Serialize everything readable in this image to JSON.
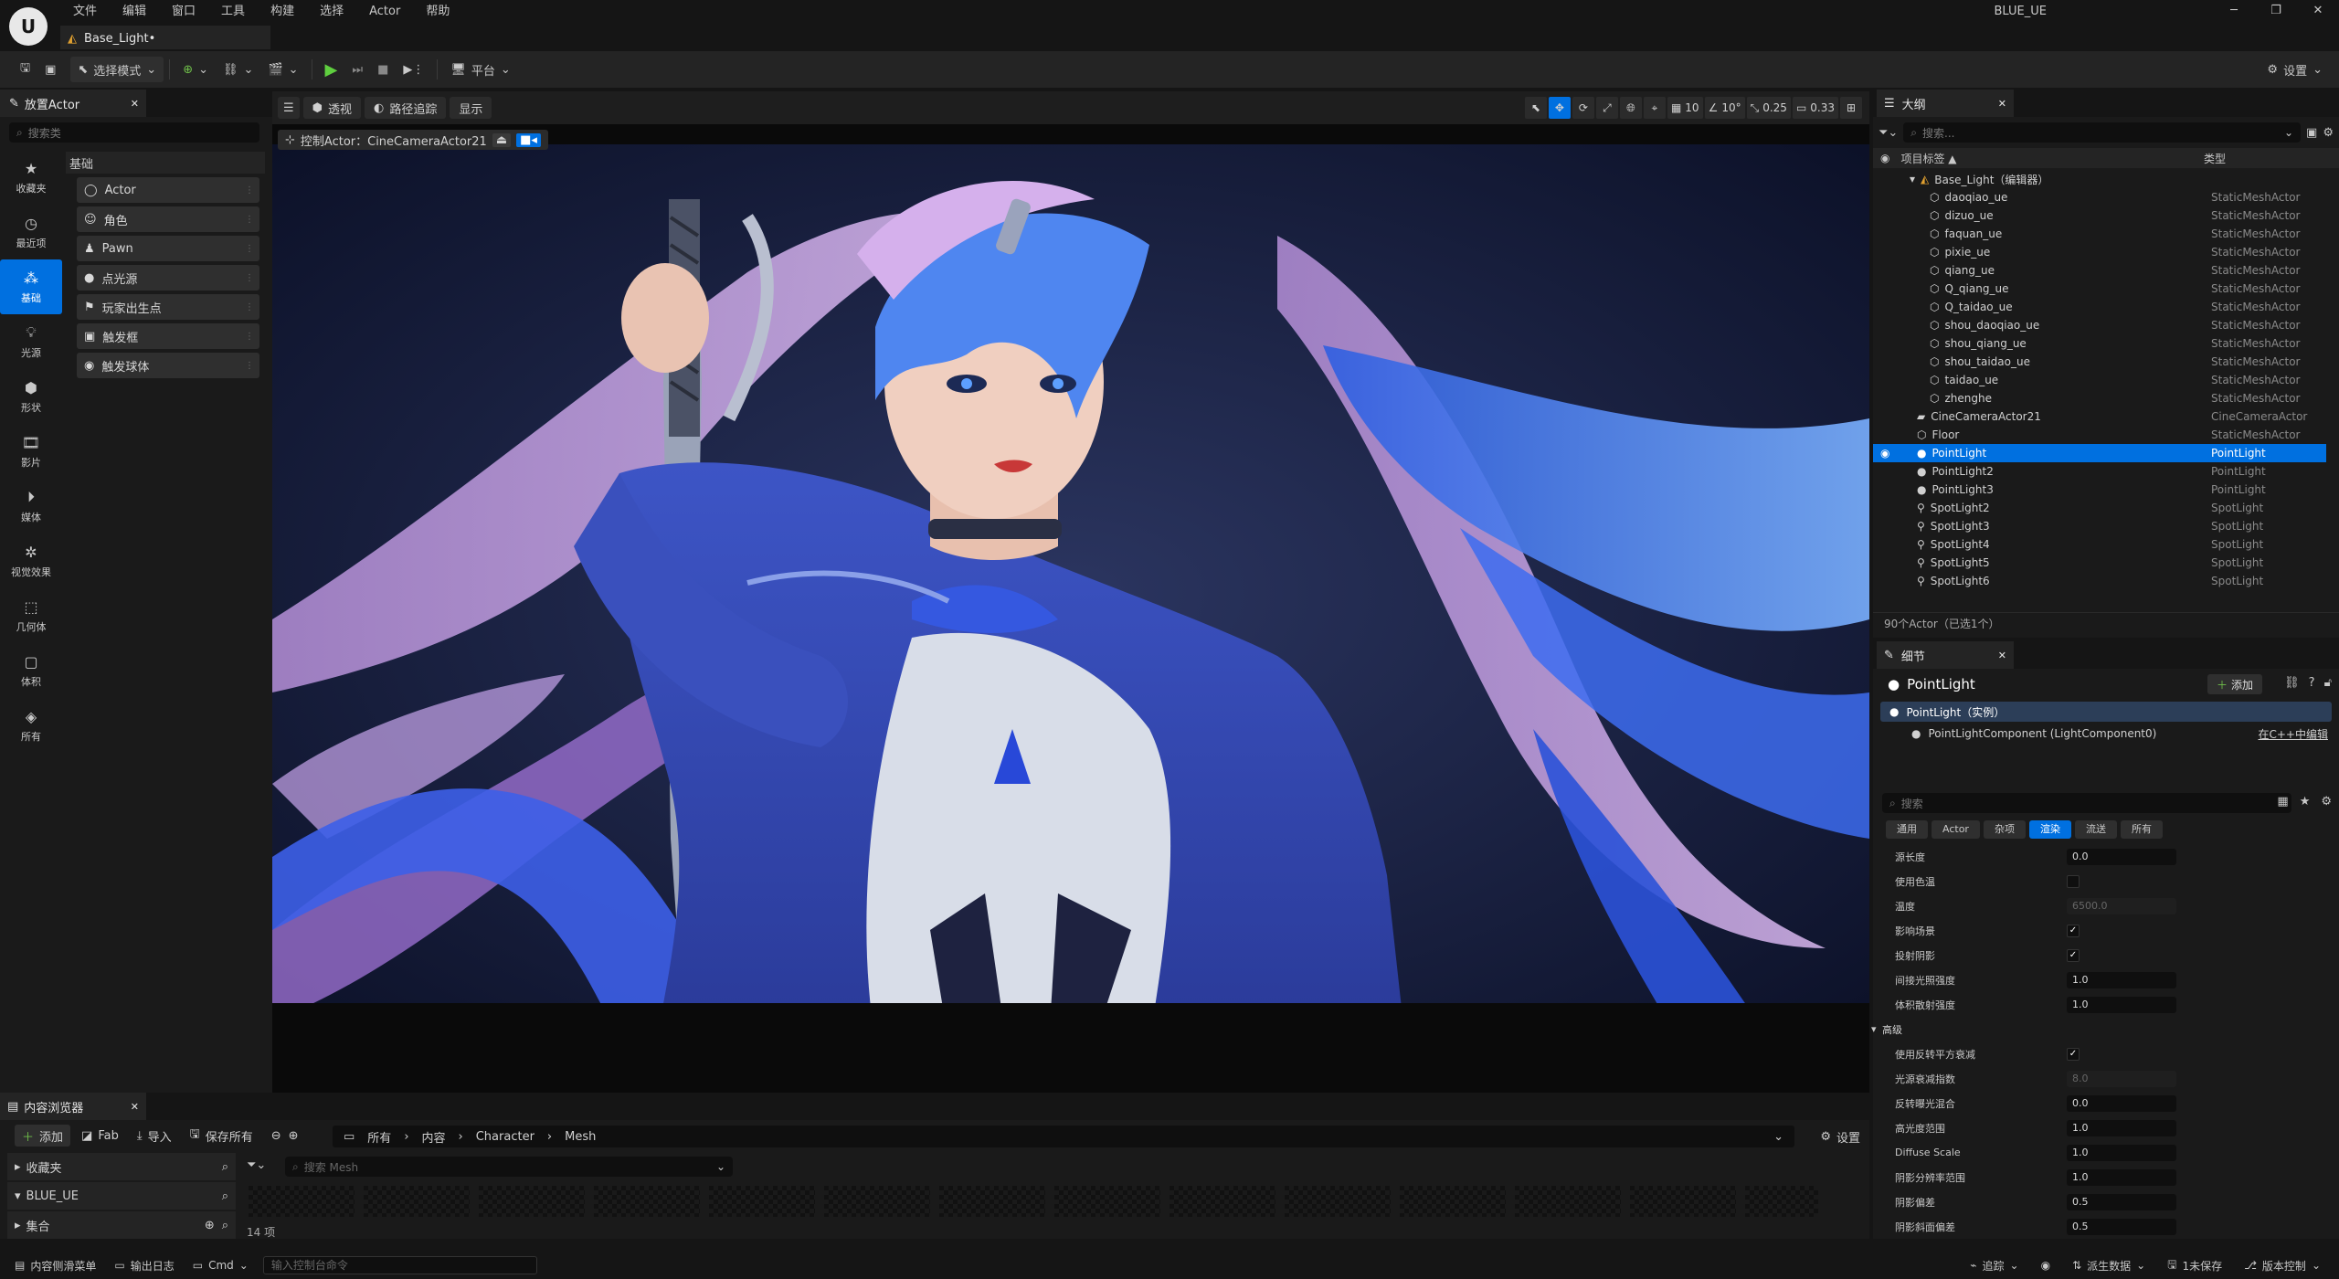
{
  "app": {
    "logo_text": "U",
    "menu": [
      "文件",
      "编辑",
      "窗口",
      "工具",
      "构建",
      "选择",
      "Actor",
      "帮助"
    ],
    "project": "BLUE_UE",
    "document_tab": "Base_Light•"
  },
  "toolbar": {
    "mode": "选择模式",
    "platform": "平台",
    "settings": "设置"
  },
  "place_actors": {
    "tab": "放置Actor",
    "search_placeholder": "搜索类",
    "categories": [
      "收藏夹",
      "最近项",
      "基础",
      "光源",
      "形状",
      "影片",
      "媒体",
      "视觉效果",
      "几何体",
      "体积",
      "所有"
    ],
    "active_category": "基础",
    "header": "基础",
    "items": [
      "Actor",
      "角色",
      "Pawn",
      "点光源",
      "玩家出生点",
      "触发框",
      "触发球体"
    ]
  },
  "viewport": {
    "perspective": "透视",
    "pathtracing": "路径追踪",
    "show": "显示",
    "pilot": "控制Actor：CineCameraActor21",
    "grid": "10",
    "angle": "10°",
    "scale": "0.25",
    "camspeed": "0.33"
  },
  "outliner": {
    "tab": "大纲",
    "search_placeholder": "搜索...",
    "col_label": "项目标签 ▲",
    "col_type": "类型",
    "root": "Base_Light（编辑器）",
    "rows": [
      {
        "name": "daoqiao_ue",
        "type": "StaticMeshActor",
        "indent": 2
      },
      {
        "name": "dizuo_ue",
        "type": "StaticMeshActor",
        "indent": 2
      },
      {
        "name": "faquan_ue",
        "type": "StaticMeshActor",
        "indent": 2
      },
      {
        "name": "pixie_ue",
        "type": "StaticMeshActor",
        "indent": 2
      },
      {
        "name": "qiang_ue",
        "type": "StaticMeshActor",
        "indent": 2
      },
      {
        "name": "Q_qiang_ue",
        "type": "StaticMeshActor",
        "indent": 2
      },
      {
        "name": "Q_taidao_ue",
        "type": "StaticMeshActor",
        "indent": 2
      },
      {
        "name": "shou_daoqiao_ue",
        "type": "StaticMeshActor",
        "indent": 2
      },
      {
        "name": "shou_qiang_ue",
        "type": "StaticMeshActor",
        "indent": 2
      },
      {
        "name": "shou_taidao_ue",
        "type": "StaticMeshActor",
        "indent": 2
      },
      {
        "name": "taidao_ue",
        "type": "StaticMeshActor",
        "indent": 2
      },
      {
        "name": "zhenghe",
        "type": "StaticMeshActor",
        "indent": 2
      },
      {
        "name": "CineCameraActor21",
        "type": "CineCameraActor",
        "indent": 1
      },
      {
        "name": "Floor",
        "type": "StaticMeshActor",
        "indent": 1
      },
      {
        "name": "PointLight",
        "type": "PointLight",
        "indent": 1,
        "selected": true
      },
      {
        "name": "PointLight2",
        "type": "PointLight",
        "indent": 1
      },
      {
        "name": "PointLight3",
        "type": "PointLight",
        "indent": 1
      },
      {
        "name": "SpotLight2",
        "type": "SpotLight",
        "indent": 1
      },
      {
        "name": "SpotLight3",
        "type": "SpotLight",
        "indent": 1
      },
      {
        "name": "SpotLight4",
        "type": "SpotLight",
        "indent": 1
      },
      {
        "name": "SpotLight5",
        "type": "SpotLight",
        "indent": 1
      },
      {
        "name": "SpotLight6",
        "type": "SpotLight",
        "indent": 1
      }
    ],
    "footer": "90个Actor（已选1个）"
  },
  "details": {
    "tab": "细节",
    "title": "PointLight",
    "add": "添加",
    "instance": "PointLight（实例）",
    "component": "PointLightComponent (LightComponent0)",
    "cpp_link": "在C++中编辑",
    "search_placeholder": "搜索",
    "tabs": [
      "通用",
      "Actor",
      "杂项",
      "渲染",
      "流送",
      "所有"
    ],
    "active_tab": "渲染",
    "props": [
      {
        "label": "源长度",
        "kind": "value",
        "value": "0.0"
      },
      {
        "label": "使用色温",
        "kind": "check",
        "checked": false
      },
      {
        "label": "温度",
        "kind": "value",
        "value": "6500.0",
        "dim": true
      },
      {
        "label": "影响场景",
        "kind": "check",
        "checked": true
      },
      {
        "label": "投射阴影",
        "kind": "check",
        "checked": true
      },
      {
        "label": "间接光照强度",
        "kind": "value",
        "value": "1.0"
      },
      {
        "label": "体积散射强度",
        "kind": "value",
        "value": "1.0"
      },
      {
        "label": "高级",
        "kind": "group"
      },
      {
        "label": "使用反转平方衰减",
        "kind": "check",
        "checked": true
      },
      {
        "label": "光源衰减指数",
        "kind": "value",
        "value": "8.0",
        "dim": true
      },
      {
        "label": "反转曝光混合",
        "kind": "value",
        "value": "0.0"
      },
      {
        "label": "高光度范围",
        "kind": "value",
        "value": "1.0"
      },
      {
        "label": "Diffuse Scale",
        "kind": "value",
        "value": "1.0"
      },
      {
        "label": "阴影分辨率范围",
        "kind": "value",
        "value": "1.0"
      },
      {
        "label": "阴影偏差",
        "kind": "value",
        "value": "0.5"
      },
      {
        "label": "阴影斜面偏差",
        "kind": "value",
        "value": "0.5"
      }
    ]
  },
  "content_browser": {
    "tab": "内容浏览器",
    "add": "添加",
    "fab": "Fab",
    "import": "导入",
    "save_all": "保存所有",
    "crumbs": [
      "所有",
      "内容",
      "Character",
      "Mesh"
    ],
    "settings": "设置",
    "left": [
      "收藏夹",
      "BLUE_UE",
      "集合"
    ],
    "search_placeholder": "搜索 Mesh",
    "item_count": "14 项"
  },
  "statusbar": {
    "drawer": "内容侧滑菜单",
    "log": "输出日志",
    "cmd": "Cmd",
    "cmd_placeholder": "输入控制台命令",
    "trace": "追踪",
    "derived": "派生数据",
    "unsaved": "1未保存",
    "revision": "版本控制"
  },
  "colors": {
    "accent": "#0070e0",
    "panel": "#1a1a1a",
    "toolbar": "#242424",
    "bg": "#151515"
  }
}
